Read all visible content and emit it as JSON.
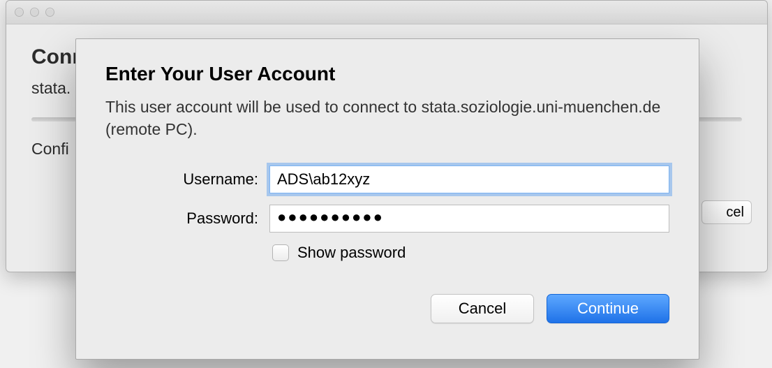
{
  "back_window": {
    "title_truncated": "Conn",
    "host_truncated": "stata.",
    "config_truncated": "Confi",
    "peek_button": "cel"
  },
  "sheet": {
    "heading": "Enter Your User Account",
    "description": "This user account will be used to connect to stata.soziologie.uni-muenchen.de (remote PC).",
    "username_label": "Username:",
    "username_value": "ADS\\ab12xyz",
    "password_label": "Password:",
    "password_mask": "●●●●●●●●●●",
    "show_password_label": "Show password",
    "show_password_checked": false,
    "cancel_label": "Cancel",
    "continue_label": "Continue"
  }
}
